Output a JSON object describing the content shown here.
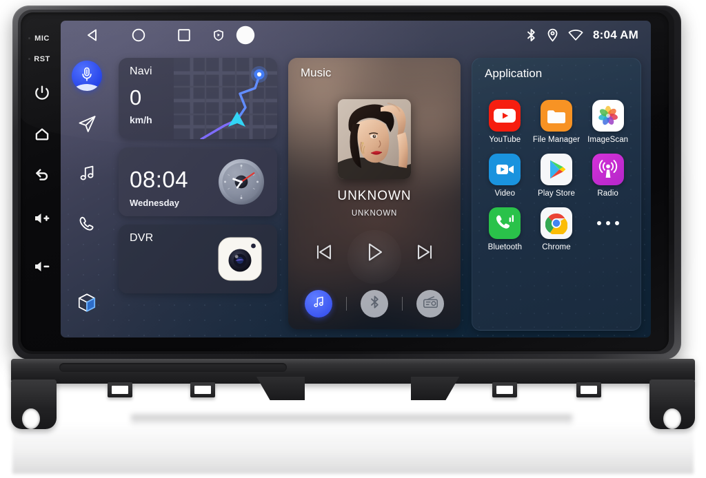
{
  "device": {
    "hardware_labels": [
      "MIC",
      "RST"
    ],
    "hardware_buttons": [
      {
        "name": "power-button",
        "icon": "power-icon"
      },
      {
        "name": "home-button",
        "icon": "home-icon"
      },
      {
        "name": "back-button",
        "icon": "back-arrow-icon"
      },
      {
        "name": "volume-up-button",
        "icon": "volume-up-icon"
      },
      {
        "name": "volume-down-button",
        "icon": "volume-down-icon"
      }
    ]
  },
  "statusbar": {
    "nav": [
      {
        "name": "android-back-button",
        "icon": "triangle-back-icon"
      },
      {
        "name": "android-home-button",
        "icon": "circle-home-icon"
      },
      {
        "name": "android-recents-button",
        "icon": "square-recents-icon"
      },
      {
        "name": "screen-record-button",
        "icon": "shield-play-icon"
      },
      {
        "name": "assistant-dot-button",
        "icon": "filled-circle-icon"
      }
    ],
    "icons": [
      "bluetooth-icon",
      "location-pin-icon",
      "wifi-icon"
    ],
    "time": "8:04 AM"
  },
  "sidebar": {
    "items": [
      {
        "name": "voice-assistant",
        "icon": "microphone-icon"
      },
      {
        "name": "navigation",
        "icon": "paper-plane-icon"
      },
      {
        "name": "music",
        "icon": "music-note-icon"
      },
      {
        "name": "phone",
        "icon": "phone-handset-icon"
      },
      {
        "name": "all-apps",
        "icon": "cube-icon"
      }
    ]
  },
  "navi_card": {
    "title": "Navi",
    "speed": "0",
    "unit": "km/h"
  },
  "clock_card": {
    "time": "08:04",
    "day": "Wednesday"
  },
  "dvr_card": {
    "title": "DVR",
    "icon": "camera-icon"
  },
  "music_card": {
    "title": "Music",
    "track": "UNKNOWN",
    "artist": "UNKNOWN",
    "transport": [
      {
        "name": "previous-track-button",
        "icon": "skip-previous-icon"
      },
      {
        "name": "play-button",
        "icon": "play-icon"
      },
      {
        "name": "next-track-button",
        "icon": "skip-next-icon"
      }
    ],
    "sources": [
      {
        "name": "source-music-button",
        "icon": "music-note-icon",
        "active": true
      },
      {
        "name": "source-bluetooth-button",
        "icon": "bluetooth-icon",
        "active": false
      },
      {
        "name": "source-radio-button",
        "icon": "radio-icon",
        "active": false
      }
    ]
  },
  "application_panel": {
    "title": "Application",
    "apps": [
      {
        "label": "YouTube",
        "icon": "youtube-icon",
        "color": "#f61c0d"
      },
      {
        "label": "File Manager",
        "icon": "folder-icon",
        "color": "#f79222"
      },
      {
        "label": "ImageScan",
        "icon": "photos-pinwheel-icon",
        "color": "#ffffff"
      },
      {
        "label": "Video",
        "icon": "video-camera-icon",
        "color": "#1a93de"
      },
      {
        "label": "Play Store",
        "icon": "play-store-icon",
        "color": "#f6f7f9"
      },
      {
        "label": "Radio",
        "icon": "broadcast-icon",
        "color": "#cb2fcf"
      },
      {
        "label": "Bluetooth",
        "icon": "green-phone-icon",
        "color": "#2ac24a"
      },
      {
        "label": "Chrome",
        "icon": "chrome-icon",
        "color": "#f6f7f9"
      },
      {
        "label": "",
        "icon": "more-dots-icon",
        "color": "transparent"
      }
    ]
  },
  "theme": {
    "accent_blue": "#3b55f0",
    "panel_navy": "#1d2f44",
    "card_slate": "#3b3c50",
    "text_white": "#ffffff"
  }
}
